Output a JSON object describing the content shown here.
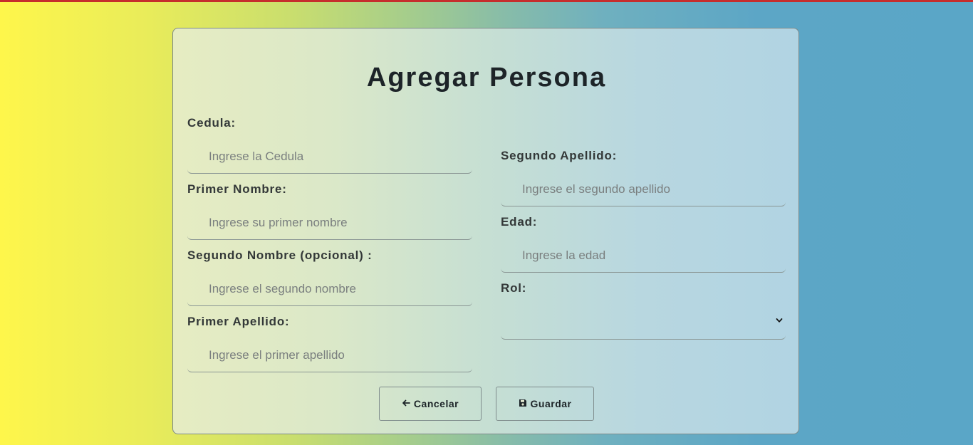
{
  "form": {
    "title": "Agregar Persona",
    "fields": {
      "cedula": {
        "label": "Cedula:",
        "placeholder": "Ingrese la Cedula"
      },
      "primer_nombre": {
        "label": "Primer Nombre:",
        "placeholder": "Ingrese su primer nombre"
      },
      "segundo_nombre": {
        "label": "Segundo Nombre (opcional) :",
        "placeholder": "Ingrese el segundo nombre"
      },
      "primer_apellido": {
        "label": "Primer Apellido:",
        "placeholder": "Ingrese el primer apellido"
      },
      "segundo_apellido": {
        "label": "Segundo Apellido:",
        "placeholder": "Ingrese el segundo apellido"
      },
      "edad": {
        "label": "Edad:",
        "placeholder": "Ingrese la edad"
      },
      "rol": {
        "label": "Rol:",
        "value": ""
      }
    },
    "buttons": {
      "cancel_icon": "←",
      "cancel_label": "Cancelar",
      "save_icon": "💾",
      "save_label": "Guardar"
    }
  },
  "icons": {
    "cancel": "arrow-left-icon",
    "save": "floppy-disk-icon",
    "select": "chevron-down-icon"
  },
  "colors": {
    "top_accent": "#c62d2d",
    "title_text": "#1d2428",
    "label_text": "#333838"
  }
}
